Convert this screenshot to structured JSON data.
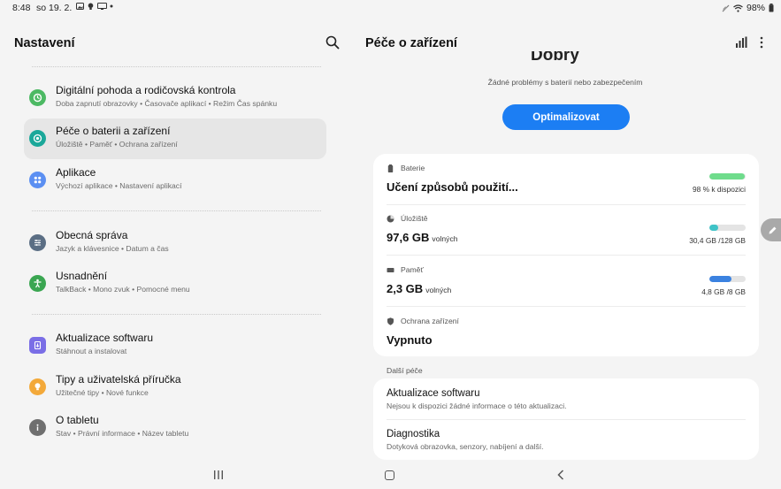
{
  "status_bar": {
    "time": "8:48",
    "date": "so 19. 2.",
    "battery": "98%"
  },
  "settings": {
    "title": "Nastavení",
    "items": [
      {
        "title": "Digitální pohoda a rodičovská kontrola",
        "subtitle": "Doba zapnutí obrazovky  •  Časovače aplikací  •  Režim Čas spánku",
        "icon": "wellbeing-icon",
        "color": "#4cb963"
      },
      {
        "title": "Péče o baterii a zařízení",
        "subtitle": "Úložiště  •  Paměť  •  Ochrana zařízení",
        "icon": "device-care-icon",
        "color": "#1ba89a"
      },
      {
        "title": "Aplikace",
        "subtitle": "Výchozí aplikace  •  Nastavení aplikací",
        "icon": "apps-icon",
        "color": "#5b8ff2"
      },
      {
        "title": "Obecná správa",
        "subtitle": "Jazyk a klávesnice  •  Datum a čas",
        "icon": "general-management-icon",
        "color": "#5b6e84"
      },
      {
        "title": "Usnadnění",
        "subtitle": "TalkBack  •  Mono zvuk  •  Pomocné menu",
        "icon": "accessibility-icon",
        "color": "#3aa651"
      },
      {
        "title": "Aktualizace softwaru",
        "subtitle": "Stáhnout a instalovat",
        "icon": "software-update-icon",
        "color": "#7a6ee6"
      },
      {
        "title": "Tipy a uživatelská příručka",
        "subtitle": "Užitečné tipy  •  Nové funkce",
        "icon": "tips-icon",
        "color": "#f3a93a"
      },
      {
        "title": "O tabletu",
        "subtitle": "Stav  •  Právní informace  •  Název tabletu",
        "icon": "info-icon",
        "color": "#6f6f6f"
      }
    ]
  },
  "device_care": {
    "title": "Péče o zařízení",
    "score_label": "Dobrý",
    "status_text": "Žádné problémy s baterií nebo zabezpečením",
    "optimize_label": "Optimalizovat",
    "battery": {
      "label": "Baterie",
      "value": "Učení způsobů použití...",
      "detail": "98 % k dispozici",
      "fill": 0.98,
      "color": "#6fdc8c"
    },
    "storage": {
      "label": "Úložiště",
      "value": "97,6 GB",
      "unit": "volných",
      "detail": "30,4 GB /128 GB",
      "fill": 0.24,
      "color": "#3fc3c7"
    },
    "memory": {
      "label": "Paměť",
      "value": "2,3 GB",
      "unit": "volných",
      "detail": "4,8 GB /8 GB",
      "fill": 0.6,
      "color": "#3b82e0"
    },
    "protection": {
      "label": "Ochrana zařízení",
      "value": "Vypnuto"
    },
    "more_care_label": "Další péče",
    "more_care": [
      {
        "title": "Aktualizace softwaru",
        "subtitle": "Nejsou k dispozici žádné informace o této aktualizaci."
      },
      {
        "title": "Diagnostika",
        "subtitle": "Dotyková obrazovka, senzory, nabíjení a další."
      }
    ]
  }
}
